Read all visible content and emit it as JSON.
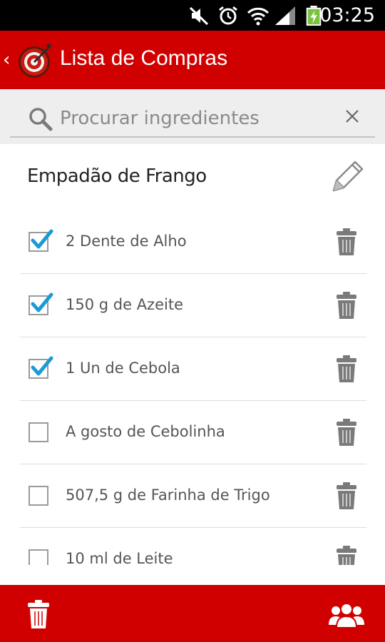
{
  "status_bar": {
    "time": "03:25",
    "icons": [
      "mute-icon",
      "alarm-icon",
      "wifi-icon",
      "signal-icon",
      "battery-charging-icon"
    ]
  },
  "action_bar": {
    "back_glyph": "‹",
    "title": "Lista de Compras",
    "logo_icon": "target-logo-icon",
    "color": "#d10000"
  },
  "search": {
    "placeholder": "Procurar ingredientes",
    "value": ""
  },
  "recipe": {
    "title": "Empadão de Frango"
  },
  "items": [
    {
      "label": "2 Dente de Alho",
      "checked": true
    },
    {
      "label": "150 g de Azeite",
      "checked": true
    },
    {
      "label": "1 Un de Cebola",
      "checked": true
    },
    {
      "label": " A gosto de Cebolinha",
      "checked": false
    },
    {
      "label": "507,5 g de Farinha de Trigo",
      "checked": false
    },
    {
      "label": "10 ml de Leite",
      "checked": false
    }
  ],
  "colors": {
    "accent": "#d10000",
    "check": "#1a9ad6",
    "icon_gray": "#7a7a7a"
  },
  "bottom_bar": {
    "left_icon": "trash-icon",
    "right_icon": "users-group-icon"
  }
}
